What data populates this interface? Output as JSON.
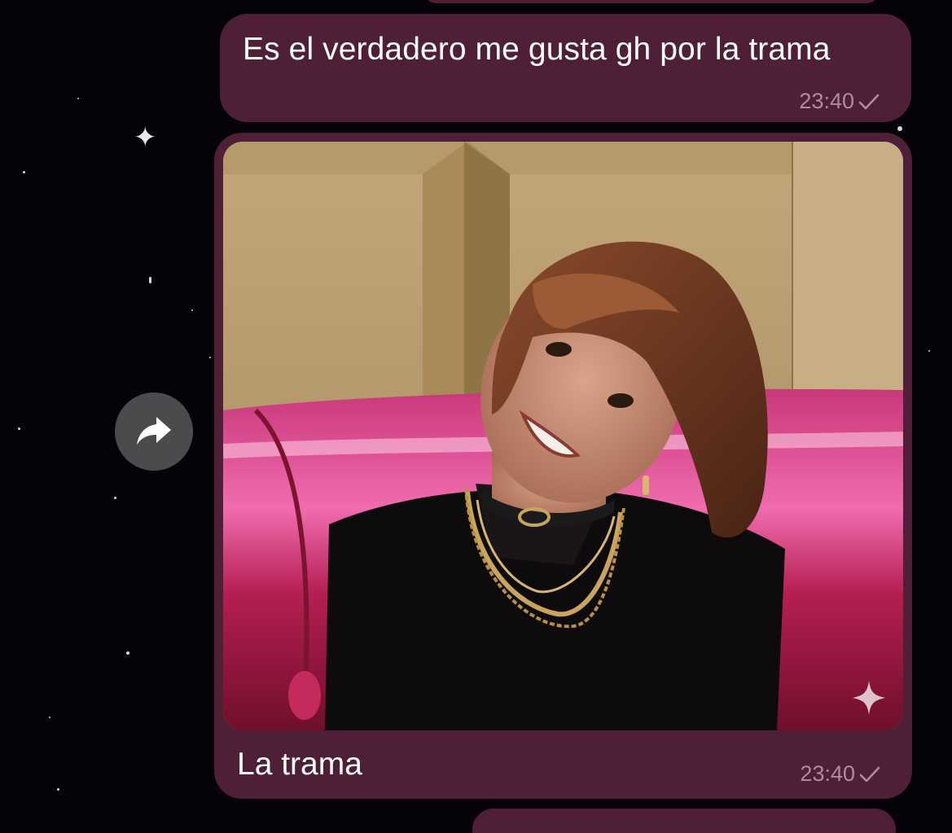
{
  "theme": {
    "background": "#050307",
    "bubble_color": "#4e1f37",
    "meta_color": "#ad8c9d"
  },
  "messages": [
    {
      "type": "text",
      "text": "Es el verdadero me gusta gh por la trama",
      "time": "23:40",
      "status_icon": "check-icon"
    },
    {
      "type": "photo",
      "caption": "La trama",
      "time": "23:40",
      "status_icon": "check-icon",
      "image_description_icon": "photo-thumbnail",
      "overlay_icon": "sparkle-icon"
    }
  ],
  "actions": {
    "forward_icon": "forward-arrow-icon"
  }
}
